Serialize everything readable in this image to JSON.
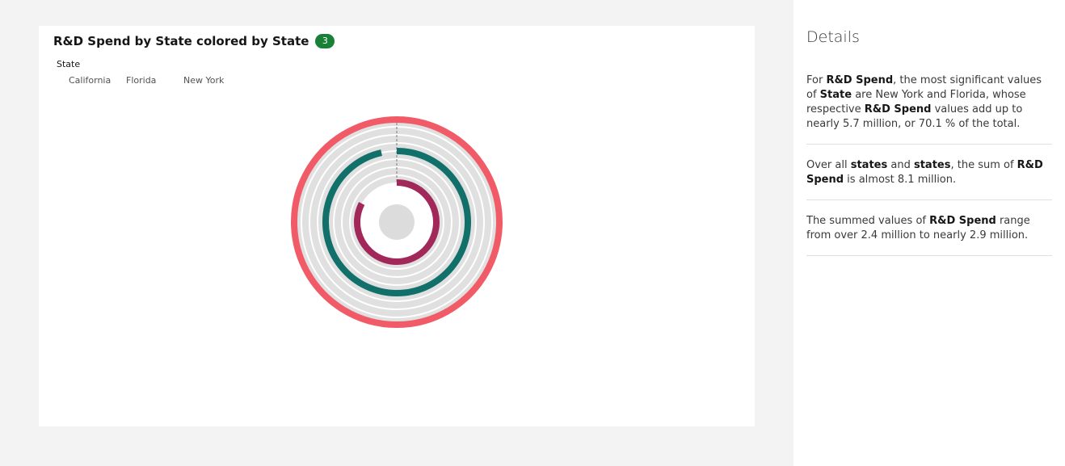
{
  "card": {
    "title": "R&D Spend by State colored by State",
    "count_badge": "3"
  },
  "legend": {
    "title": "State",
    "items": [
      "California",
      "Florida",
      "New York"
    ]
  },
  "colors": {
    "badge": "#198038",
    "track": "#e0e0e0",
    "California": "#a2191f",
    "Florida": "#007d79",
    "New York": "#fa4d56"
  },
  "chart_data": {
    "type": "radial-bar",
    "title": "R&D Spend by State colored by State",
    "legend_title": "State",
    "legend_placement": "top-left",
    "categories": [
      "California",
      "Florida",
      "New York"
    ],
    "series": [
      {
        "name": "California",
        "value": 2400000,
        "color": "#a2285a"
      },
      {
        "name": "Florida",
        "value": 2800000,
        "color": "#12706b"
      },
      {
        "name": "New York",
        "value": 2900000,
        "color": "#f15b67"
      }
    ],
    "max": 2900000,
    "total": 8100000
  },
  "details": {
    "title": "Details",
    "insights": [
      [
        {
          "t": "For ",
          "b": false
        },
        {
          "t": "R&D Spend",
          "b": true
        },
        {
          "t": ", the most significant values of ",
          "b": false
        },
        {
          "t": "State",
          "b": true
        },
        {
          "t": " are New York and Florida, whose respective ",
          "b": false
        },
        {
          "t": "R&D Spend",
          "b": true
        },
        {
          "t": " values add up to nearly 5.7 million, or 70.1 % of the total.",
          "b": false
        }
      ],
      [
        {
          "t": "Over all ",
          "b": false
        },
        {
          "t": "states",
          "b": true
        },
        {
          "t": " and ",
          "b": false
        },
        {
          "t": "states",
          "b": true
        },
        {
          "t": ", the sum of ",
          "b": false
        },
        {
          "t": "R&D Spend",
          "b": true
        },
        {
          "t": " is almost 8.1 million.",
          "b": false
        }
      ],
      [
        {
          "t": "The summed values of ",
          "b": false
        },
        {
          "t": "R&D Spend",
          "b": true
        },
        {
          "t": " range from over 2.4 million to nearly 2.9 million.",
          "b": false
        }
      ]
    ]
  }
}
